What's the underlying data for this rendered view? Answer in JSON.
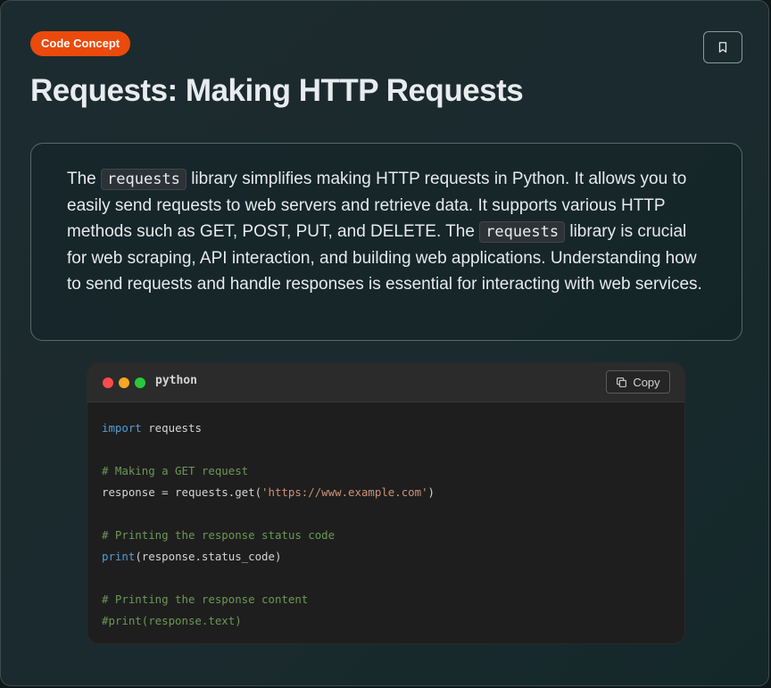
{
  "badge": "Code Concept",
  "title": "Requests: Making HTTP Requests",
  "description": {
    "t1": "The ",
    "code1": "requests",
    "t2": " library simplifies making HTTP requests in Python. It allows you to easily send requests to web servers and retrieve data. It supports various HTTP methods such as GET, POST, PUT, and DELETE. The ",
    "code2": "requests",
    "t3": " library is crucial for web scraping, API interaction, and building web applications. Understanding how to send requests and handle responses is essential for interacting with web services."
  },
  "code_block": {
    "language": "python",
    "copy_label": "Copy",
    "lines": {
      "l1_kw": "import",
      "l1_rest": " requests",
      "l3": "# Making a GET request",
      "l4_a": "response = requests.get(",
      "l4_str": "'https://www.example.com'",
      "l4_b": ")",
      "l6": "# Printing the response status code",
      "l7_fn": "print",
      "l7_rest": "(response.status_code)",
      "l9": "# Printing the response content",
      "l10": "#print(response.text)"
    }
  },
  "icons": {
    "bookmark": "bookmark-icon",
    "copy": "copy-icon"
  },
  "colors": {
    "badge": "#ea4a0c",
    "keyword": "#569cd6",
    "comment": "#6a9955",
    "string": "#ce9178"
  }
}
